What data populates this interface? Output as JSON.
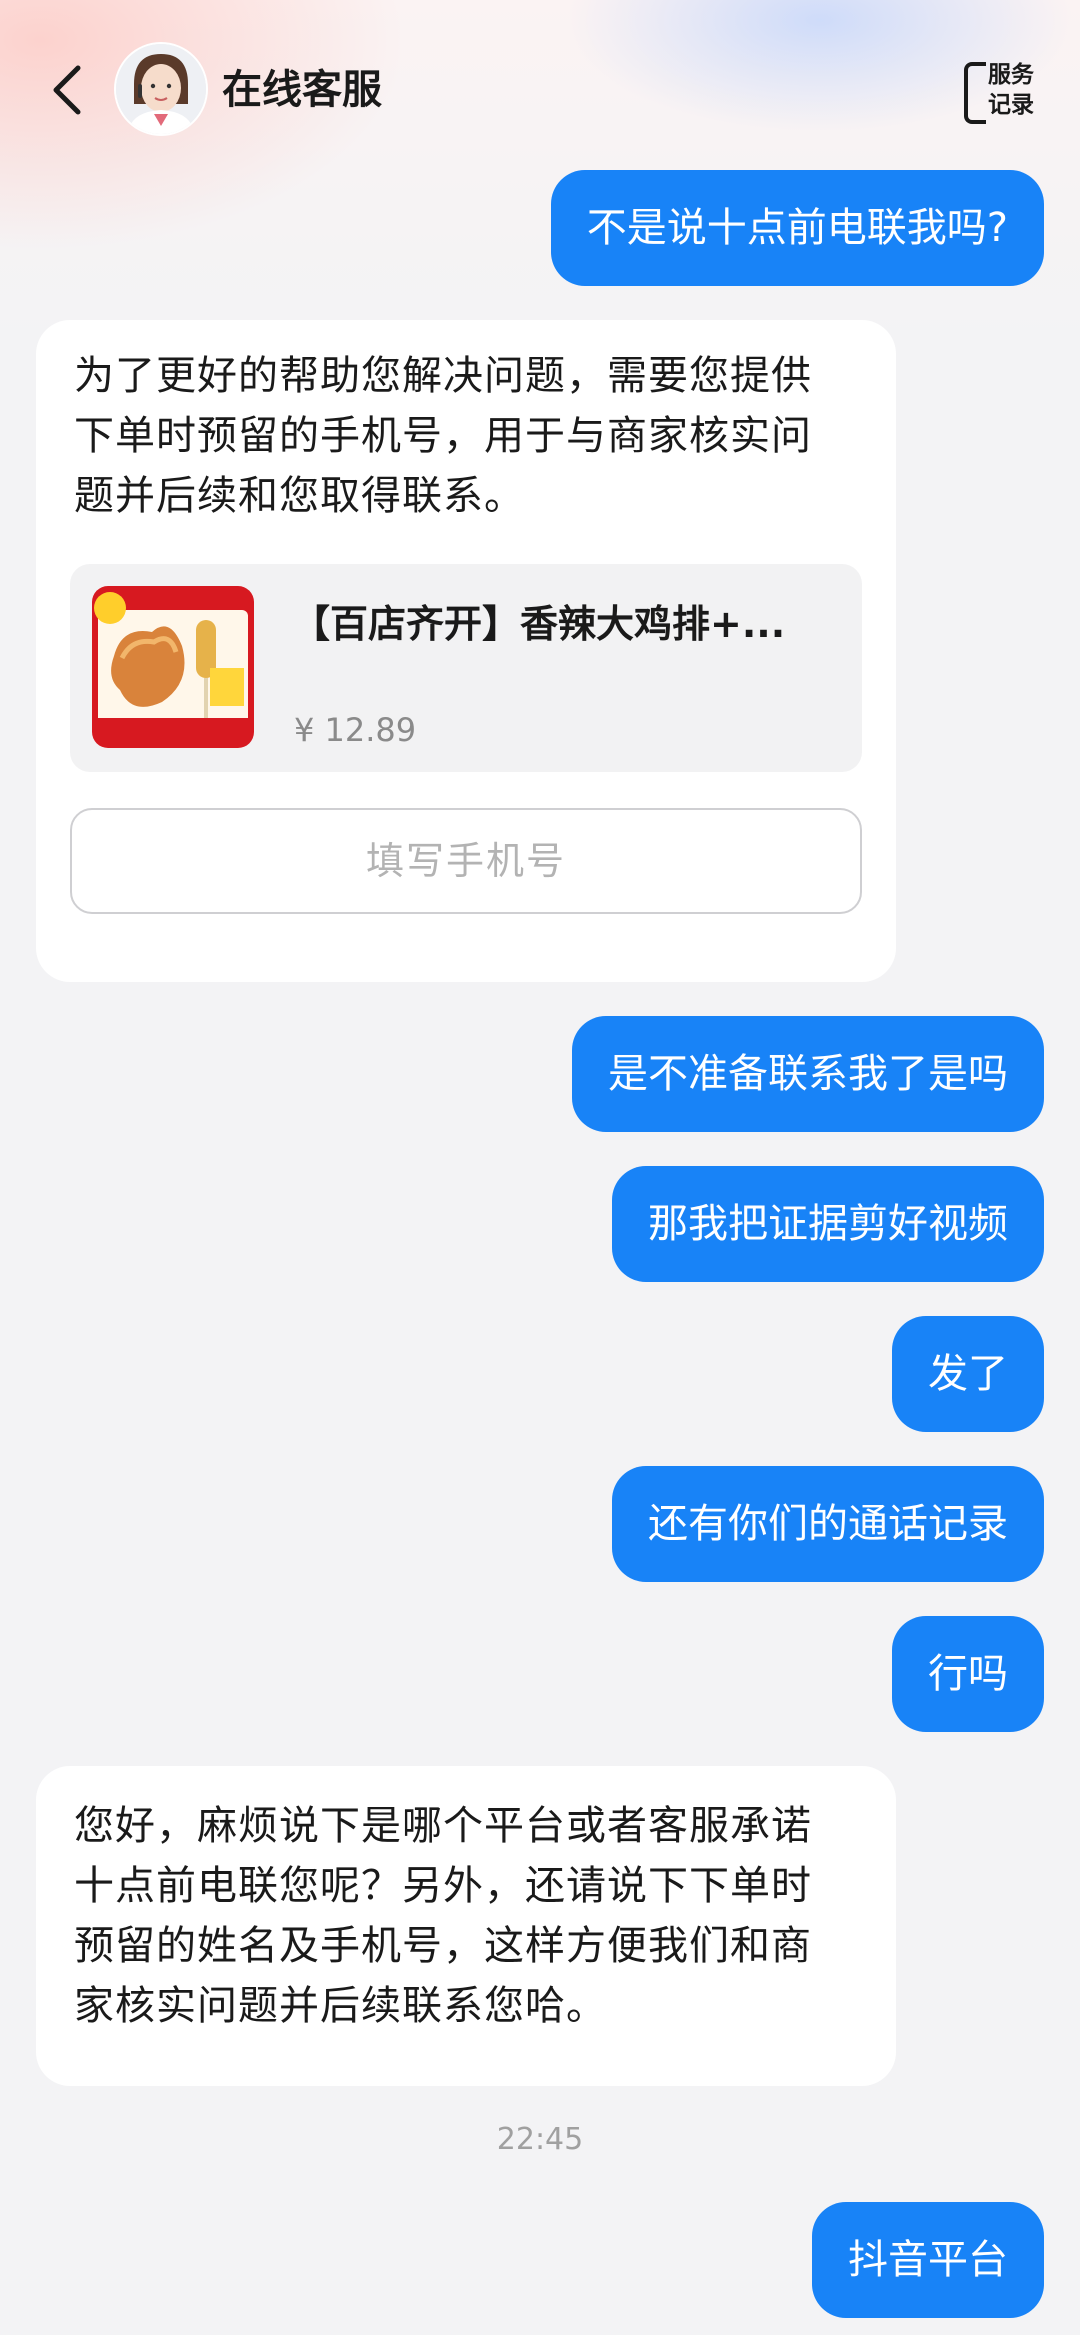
{
  "header": {
    "title": "在线客服",
    "service_record_line1": "服务",
    "service_record_line2": "记录"
  },
  "messages": {
    "m1": "不是说十点前电联我吗?",
    "m2_line1": "为了更好的帮助您解决问题，需要您提供",
    "m2_line2": "下单时预留的手机号，用于与商家核实问",
    "m2_line3": "题并后续和您取得联系。",
    "m3": "是不准备联系我了是吗",
    "m4": "那我把证据剪好视频",
    "m5": "发了",
    "m6": "还有你们的通话记录",
    "m7": "行吗",
    "m8_line1": "您好，麻烦说下是哪个平台或者客服承诺",
    "m8_line2": "十点前电联您呢？另外，还请说下下单时",
    "m8_line3": "预留的姓名及手机号，这样方便我们和商",
    "m8_line4": "家核实问题并后续联系您哈。",
    "m9": "抖音平台"
  },
  "product": {
    "name": "【百店齐开】香辣大鸡排+...",
    "price": "¥ 12.89"
  },
  "phone_button_label": "填写手机号",
  "timestamp": "22:45",
  "colors": {
    "accent": "#1883f7",
    "background": "#f3f3f5"
  }
}
